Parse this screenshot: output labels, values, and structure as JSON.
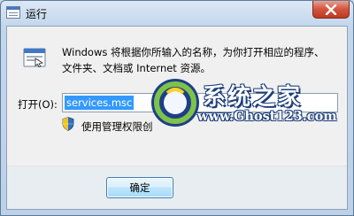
{
  "window": {
    "title": "运行"
  },
  "description": {
    "line1": "Windows 将根据你所输入的名称，为你打开相应的程序、",
    "line2": "文件夹、文档或 Internet 资源。"
  },
  "open": {
    "label": "打开(O):",
    "value": "services.msc"
  },
  "admin_notice": "使用管理权限创",
  "buttons": {
    "ok": "确定"
  },
  "watermark": {
    "title": "系统之家",
    "url": "www.Ghost123.com"
  }
}
